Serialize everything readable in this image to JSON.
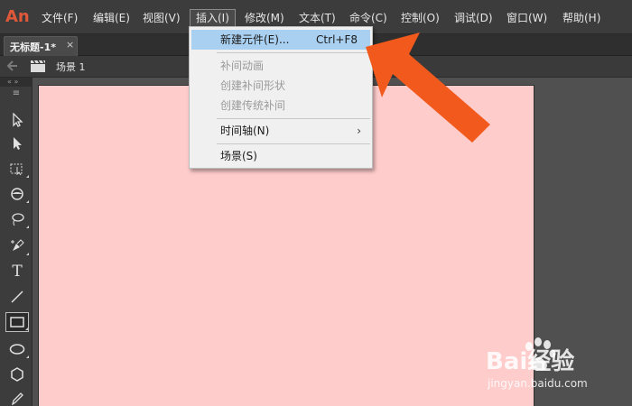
{
  "app": {
    "logo": "An",
    "accent_color": "#e0583a"
  },
  "menubar": {
    "items": [
      {
        "label": "文件(F)"
      },
      {
        "label": "编辑(E)"
      },
      {
        "label": "视图(V)"
      },
      {
        "label": "插入(I)"
      },
      {
        "label": "修改(M)"
      },
      {
        "label": "文本(T)"
      },
      {
        "label": "命令(C)"
      },
      {
        "label": "控制(O)"
      },
      {
        "label": "调试(D)"
      },
      {
        "label": "窗口(W)"
      },
      {
        "label": "帮助(H)"
      }
    ],
    "active_item": "插入(I)"
  },
  "tab": {
    "title": "无标题-1*",
    "close": "×"
  },
  "scene": {
    "label": "场景 1"
  },
  "toolbar": {
    "header": "« »",
    "grip": "≡",
    "tools": [
      {
        "name": "selection-tool"
      },
      {
        "name": "subselection-tool"
      },
      {
        "name": "free-transform-tool"
      },
      {
        "name": "3d-rotation-tool"
      },
      {
        "name": "lasso-tool"
      },
      {
        "name": "pen-tool"
      },
      {
        "name": "text-tool",
        "glyph": "T"
      },
      {
        "name": "line-tool"
      },
      {
        "name": "rectangle-tool",
        "selected": true
      },
      {
        "name": "oval-tool"
      },
      {
        "name": "polystar-tool"
      },
      {
        "name": "pencil-tool"
      }
    ]
  },
  "stage": {
    "background": "#ffcccc"
  },
  "dropdown": {
    "items": [
      {
        "label": "新建元件(E)...",
        "shortcut": "Ctrl+F8",
        "highlight": true
      },
      {
        "label": "补间动画",
        "disabled": true
      },
      {
        "label": "创建补间形状",
        "disabled": true
      },
      {
        "label": "创建传统补间",
        "disabled": true
      },
      {
        "label": "时间轴(N)",
        "submenu": "›"
      },
      {
        "label": "场景(S)"
      }
    ]
  },
  "annotation": {
    "arrow_color": "#f25a1d"
  },
  "watermark": {
    "brand": "Bai经验",
    "sub": "jingyan.baidu.com"
  }
}
